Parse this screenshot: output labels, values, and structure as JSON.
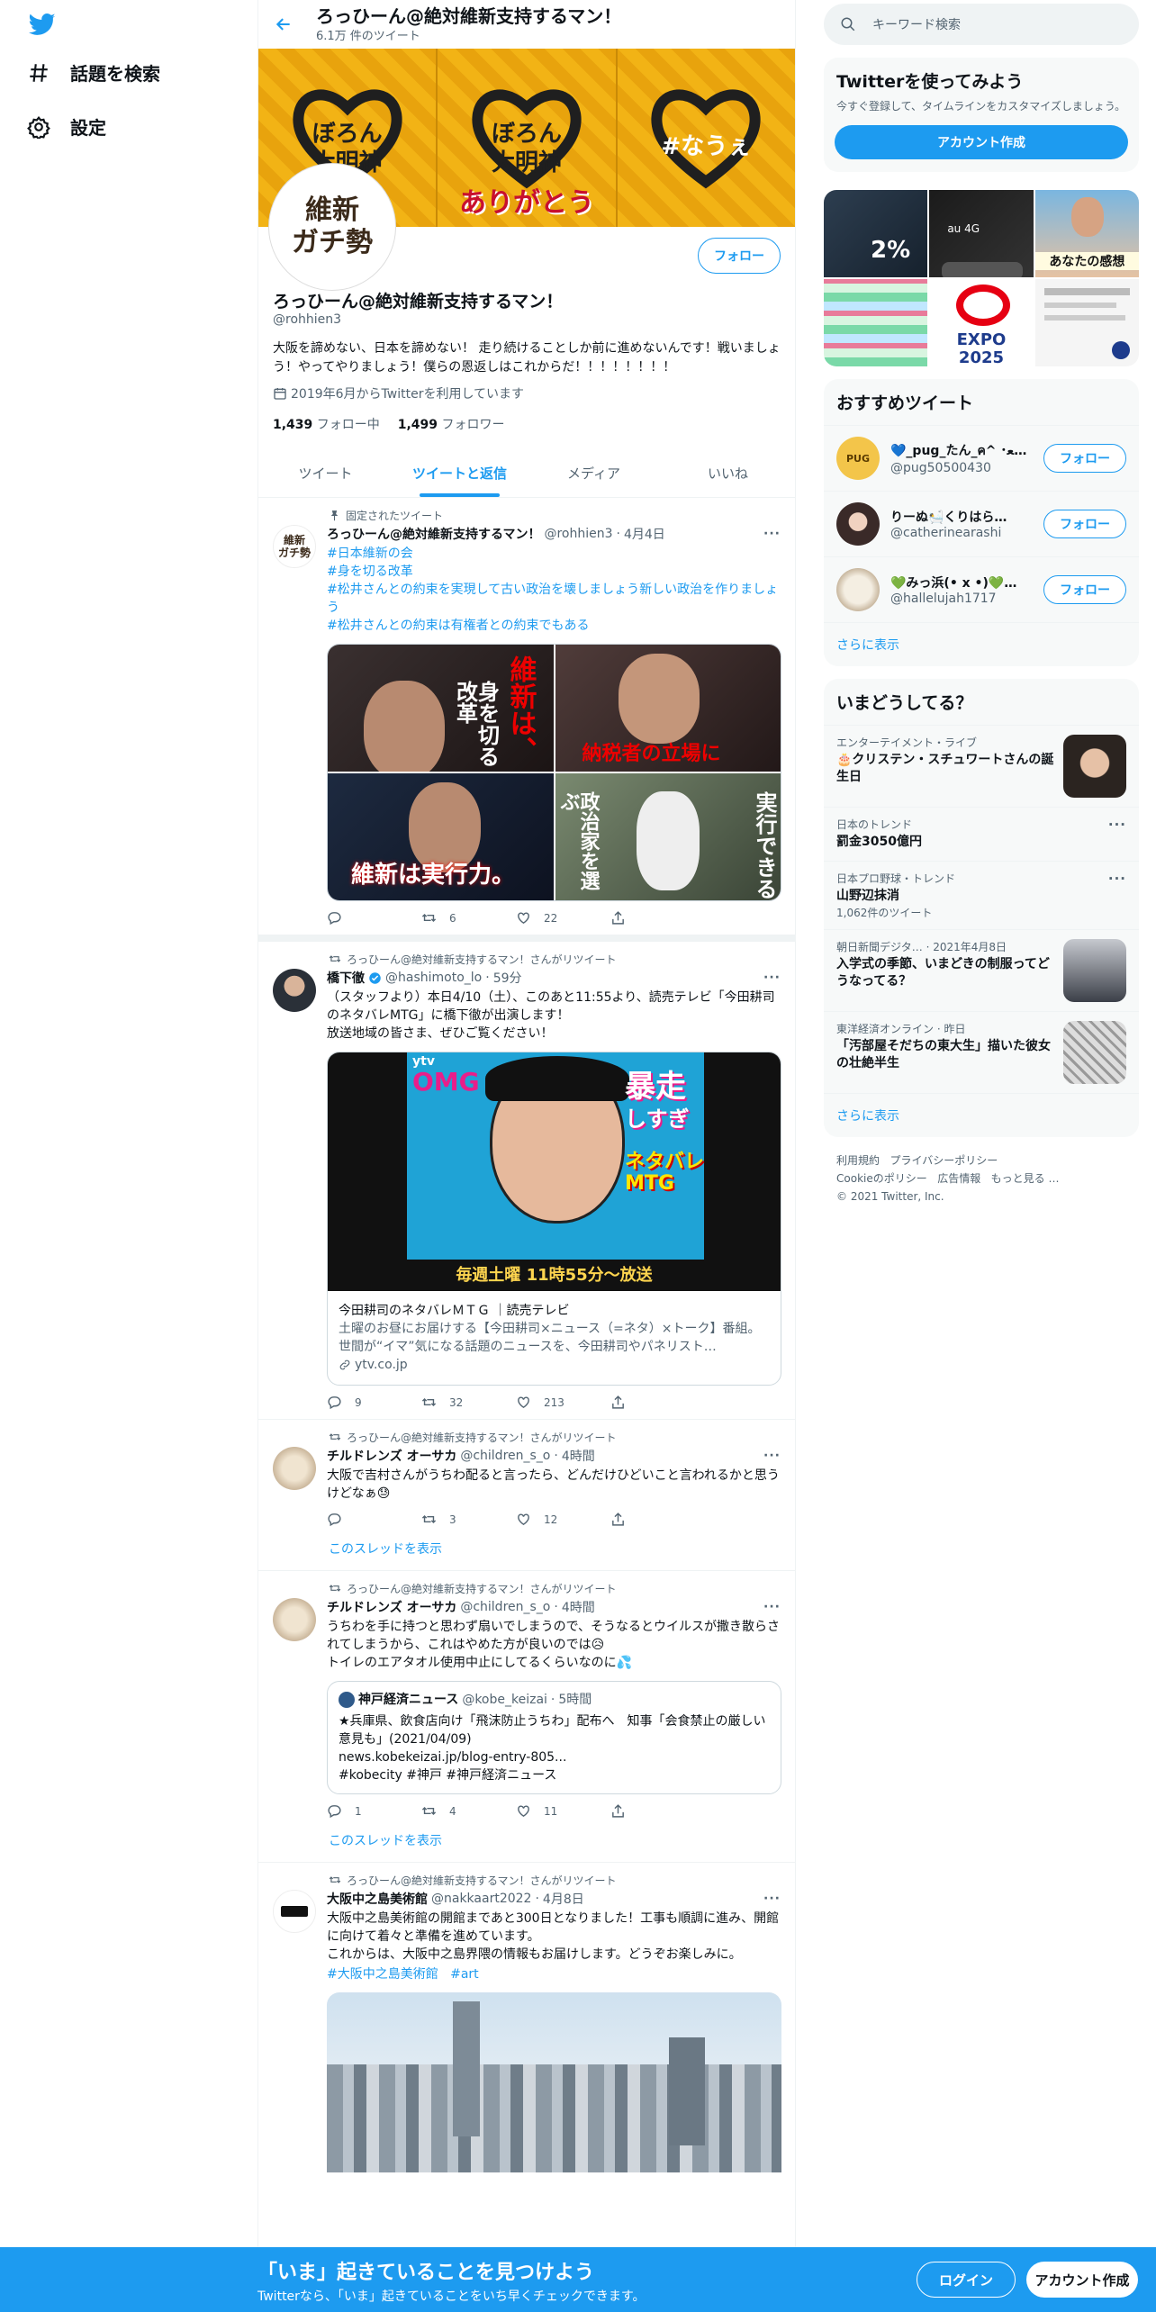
{
  "nav": {
    "explore": "話題を検索",
    "settings": "設定"
  },
  "header": {
    "title": "ろっひーん@絶対維新支持するマン！",
    "tweet_count": "6.1万 件のツイート"
  },
  "banner": {
    "p1_top": "ぼろん",
    "p1_bottom": "大明神",
    "p2_top": "ぼろん",
    "p2_bottom": "大明神",
    "p2_caption": "ありがとう",
    "p3_text": "#なうぇ"
  },
  "profile": {
    "avatar_line1": "維新",
    "avatar_line2": "ガチ勢",
    "follow_button": "フォロー",
    "name": "ろっひーん@絶対維新支持するマン！",
    "handle": "@rohhien3",
    "bio": "大阪を諦めない、日本を諦めない！ 走り続けることしか前に進めないんです！戦いましょう！やってやりましょう！僕らの恩返しはこれからだ！！！！！！！！",
    "joined": "2019年6月からTwitterを利用しています",
    "following_count": "1,439",
    "following_label": "フォロー中",
    "followers_count": "1,499",
    "followers_label": "フォロワー"
  },
  "tabs": [
    "ツイート",
    "ツイートと返信",
    "メディア",
    "いいね"
  ],
  "tweets": [
    {
      "context": "固定されたツイート",
      "name": "ろっひーん@絶対維新支持するマン！",
      "handle": "@rohhien3",
      "time": "4月4日",
      "hashtags": [
        "#日本維新の会",
        "#身を切る改革",
        "#松井さんとの約束を実現して古い政治を壊しましょう新しい政治を作りましょう",
        "#松井さんとの約束は有権者との約束でもある"
      ],
      "media_text": [
        "維新は、",
        "身を切る改革",
        "納税者の立場に",
        "維新は実行力。",
        "政治家を選ぶ",
        "実行できる"
      ],
      "replies": "",
      "retweets": "6",
      "likes": "22"
    },
    {
      "context": "ろっひーん@絶対維新支持するマン！さんがリツイート",
      "name": "橋下徹",
      "handle": "@hashimoto_lo",
      "time": "59分",
      "text": "（スタッフより）本日4/10（土）、このあと11:55より、読売テレビ「今田耕司のネタバレMTG」に橋下徹が出演します！\n放送地域の皆さま、ぜひご覧ください！",
      "card_banner": "毎週土曜 11時55分〜放送",
      "card_title": "今田耕司のネタバレＭＴＧ ｜読売テレビ",
      "card_desc": "土曜のお昼にお届けする【今田耕司×ニュース（=ネタ）×トーク】番組。世間が“イマ”気になる話題のニュースを、今田耕司やパネリスト…",
      "card_domain": "ytv.co.jp",
      "card_logo": "ネタバレ MTG",
      "card_words": [
        "OMG",
        "暴走",
        "しすぎ",
        "ytv"
      ],
      "replies": "9",
      "retweets": "32",
      "likes": "213"
    },
    {
      "context": "ろっひーん@絶対維新支持するマン！さんがリツイート",
      "name": "チルドレンズ オーサカ",
      "handle": "@children_s_o",
      "time": "4時間",
      "text": "大阪で吉村さんがうちわ配ると言ったら、どんだけひどいこと言われるかと思うけどなぁ😓",
      "replies": "",
      "retweets": "3",
      "likes": "12",
      "thread": "このスレッドを表示"
    },
    {
      "context": "ろっひーん@絶対維新支持するマン！さんがリツイート",
      "name": "チルドレンズ オーサカ",
      "handle": "@children_s_o",
      "time": "4時間",
      "text": "うちわを手に持つと思わず扇いでしまうので、そうなるとウイルスが撒き散らされてしまうから、これはやめた方が良いのでは😥\nトイレのエアタオル使用中止にしてるくらいなのに💦",
      "quote_name": "神戸経済ニュース",
      "quote_handle": "@kobe_keizai",
      "quote_time": "5時間",
      "quote_text": "★兵庫県、飲食店向け「飛沫防止うちわ」配布へ　知事「会食禁止の厳しい意見も」(2021/04/09)\nnews.kobekeizai.jp/blog-entry-805...\n#kobecity #神戸 #神戸経済ニュース",
      "replies": "1",
      "retweets": "4",
      "likes": "11",
      "thread": "このスレッドを表示"
    },
    {
      "context": "ろっひーん@絶対維新支持するマン！さんがリツイート",
      "name": "大阪中之島美術館",
      "handle": "@nakkaart2022",
      "time": "4月8日",
      "text": "大阪中之島美術館の開館まであと300日となりました！工事も順調に進み、開館に向けて着々と準備を進めています。\nこれからは、大阪中之島界隈の情報もお届けします。どうぞお楽しみに。",
      "hashtags": [
        "#大阪中之島美術館",
        "#art"
      ]
    }
  ],
  "right": {
    "search_placeholder": "キーワード検索",
    "signup_title": "Twitterを使ってみよう",
    "signup_desc": "今すぐ登録して、タイムラインをカスタマイズしましょう。",
    "signup_button": "アカウント作成",
    "photo_texts": [
      "2%",
      "au 4G",
      "あなたの感想",
      "EXPO 2025"
    ],
    "recommend_title": "おすすめツイート",
    "recommend": [
      {
        "name": "💙_pug_たん_ค^ ･ﻌ･^ค",
        "handle": "@pug50500430",
        "avatar_text": "PUG"
      },
      {
        "name": "りーぬ🛀くりはら…",
        "handle": "@catherinearashi",
        "avatar_text": ""
      },
      {
        "name": "💚みっ浜(• x •)💚…",
        "handle": "@hallelujah1717",
        "avatar_text": ""
      }
    ],
    "follow_label": "フォロー",
    "show_more": "さらに表示",
    "trends_title": "いまどうしてる？",
    "trends": [
      {
        "meta": "エンターテイメント・ライブ",
        "title": "🎂クリステン・スチュワートさんの誕生日",
        "thumb": "photo"
      },
      {
        "meta": "日本のトレンド",
        "title": "罰金3050億円",
        "thumb": ""
      },
      {
        "meta": "日本プロ野球・トレンド",
        "title": "山野辺抹消",
        "count": "1,062件のツイート",
        "thumb": ""
      },
      {
        "meta": "朝日新聞デジタ… · 2021年4月8日",
        "title": "入学式の季節、いまどきの制服ってどうなってる？",
        "thumb": "photo"
      },
      {
        "meta": "東洋経済オンライン · 昨日",
        "title": "「汚部屋そだちの東大生」描いた彼女の壮絶半生",
        "thumb": "photo"
      }
    ],
    "footer": [
      "利用規約",
      "プライバシーポリシー",
      "Cookieのポリシー",
      "広告情報",
      "もっと見る …",
      "© 2021 Twitter, Inc."
    ]
  },
  "bottom": {
    "title": "「いま」起きていることを見つけよう",
    "subtitle": "Twitterなら、「いま」起きていることをいち早くチェックできます。",
    "login": "ログイン",
    "signup": "アカウント作成"
  },
  "colors": {
    "accent": "#1d9bf0",
    "text": "#0f1419",
    "muted": "#536471"
  }
}
